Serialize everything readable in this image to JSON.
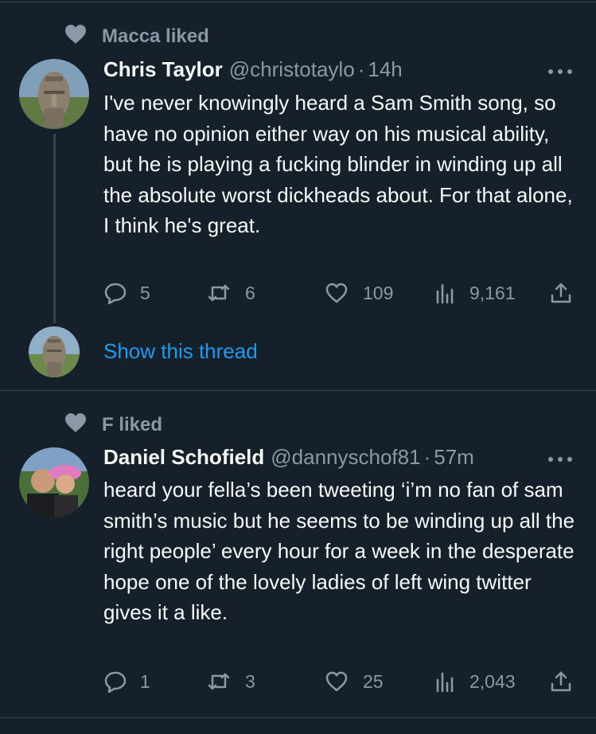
{
  "tweets": [
    {
      "liked_by": "Macca liked",
      "author": {
        "name": "Chris Taylor",
        "handle": "@christotaylo",
        "time": "14h"
      },
      "text": "I've never knowingly heard a Sam Smith song, so have no opinion either way on his musical ability, but he is playing a fucking blinder in winding up all the absolute worst dickheads about. For that alone, I think he's great.",
      "metrics": {
        "replies": "5",
        "retweets": "6",
        "likes": "109",
        "views": "9,161"
      },
      "show_thread_label": "Show this thread"
    },
    {
      "liked_by": "F liked",
      "author": {
        "name": "Daniel Schofield",
        "handle": "@dannyschof81",
        "time": "57m"
      },
      "text": "heard your fella’s been tweeting ‘i’m no fan of sam smith’s music but he seems to be winding up all the right people’ every hour for a week in the desperate hope one of the lovely ladies of left wing twitter gives it a like.",
      "metrics": {
        "replies": "1",
        "retweets": "3",
        "likes": "25",
        "views": "2,043"
      }
    }
  ],
  "separator": "·",
  "icons": {
    "context": "heart-icon",
    "more": "more-icon",
    "reply": "reply-icon",
    "retweet": "retweet-icon",
    "like": "heart-icon",
    "views": "views-icon",
    "share": "share-icon"
  },
  "colors": {
    "background": "#15202b",
    "text": "#f7f9f9",
    "secondary": "#8b98a5",
    "link": "#1d9bf0",
    "divider": "#38444d"
  }
}
